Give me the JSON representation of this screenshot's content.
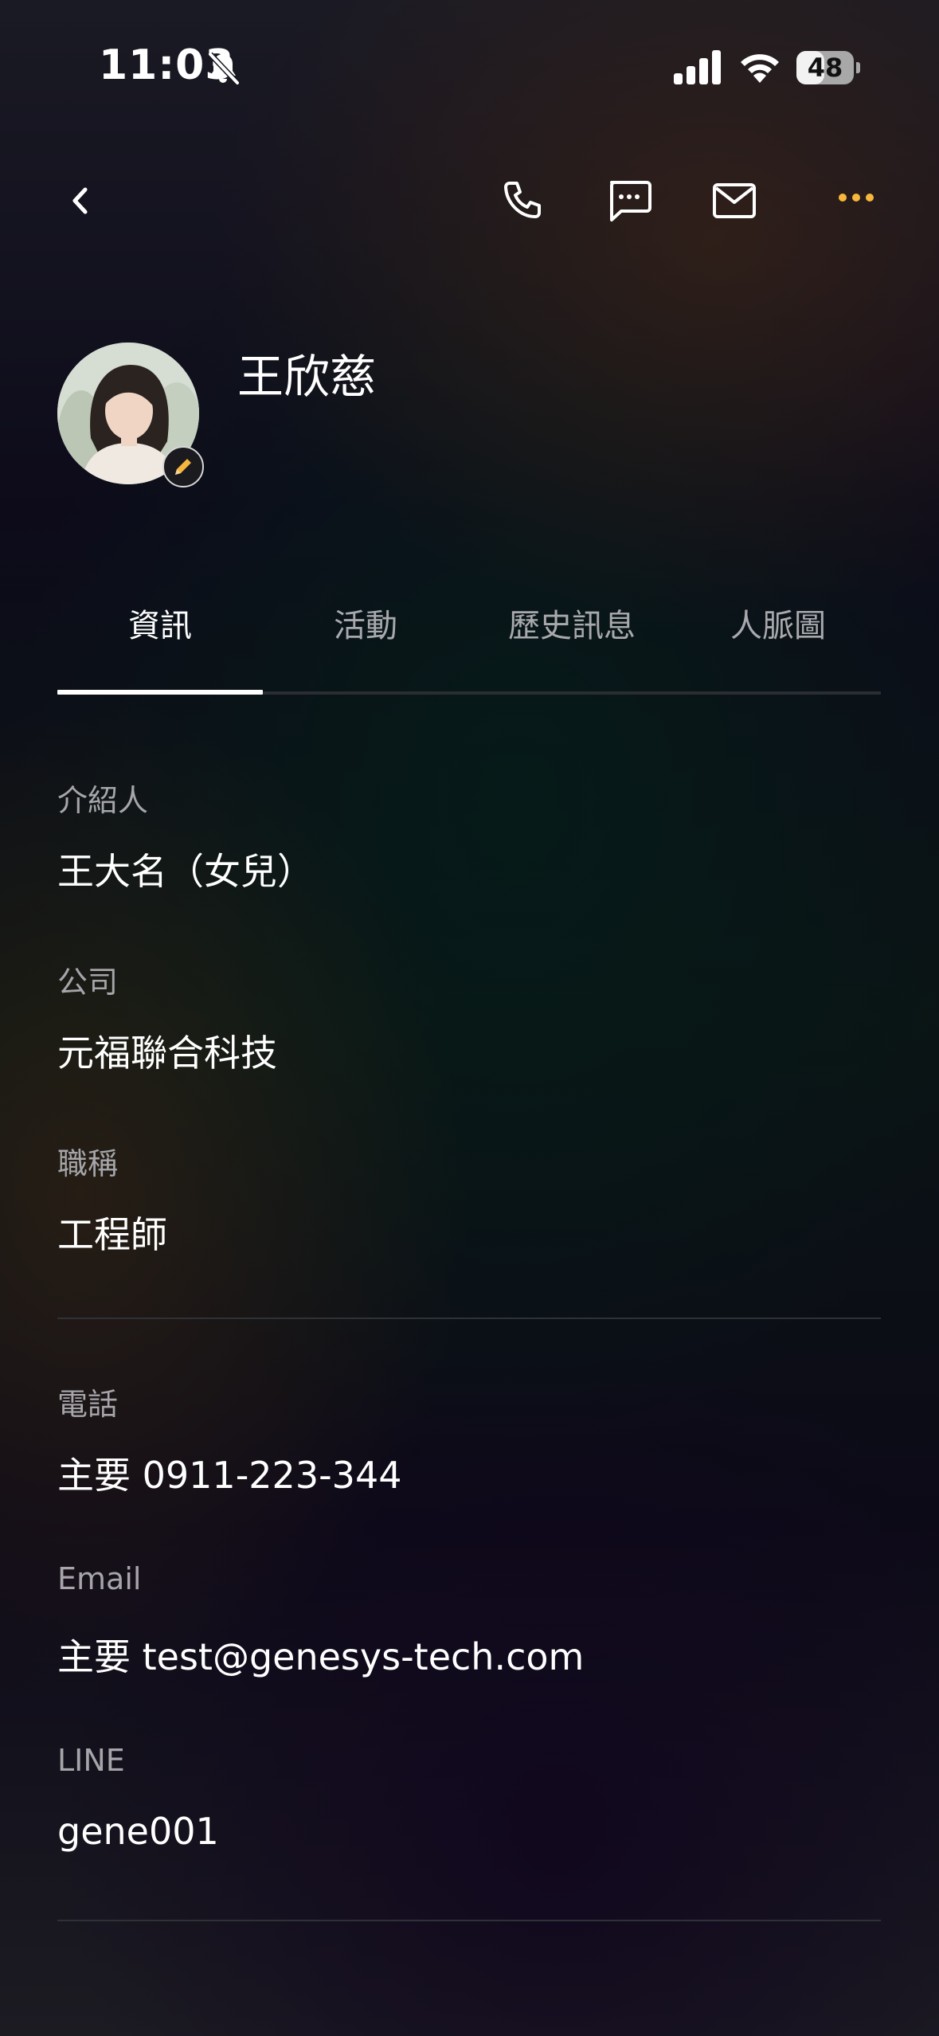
{
  "status_bar": {
    "time": "11:03",
    "battery_level": "48"
  },
  "toolbar": {
    "back_icon": "chevron-left-icon",
    "call_icon": "phone-icon",
    "message_icon": "message-bubble-icon",
    "email_icon": "envelope-icon",
    "more_icon": "ellipsis-icon",
    "accent_color": "#f6b73c"
  },
  "profile": {
    "name": "王欣慈",
    "edit_icon": "pencil-icon"
  },
  "tabs": [
    {
      "label": "資訊",
      "active": true
    },
    {
      "label": "活動",
      "active": false
    },
    {
      "label": "歷史訊息",
      "active": false
    },
    {
      "label": "人脈圖",
      "active": false
    }
  ],
  "info": {
    "referrer": {
      "label": "介紹人",
      "value": "王大名（女兒）"
    },
    "company": {
      "label": "公司",
      "value": "元福聯合科技"
    },
    "title": {
      "label": "職稱",
      "value": "工程師"
    },
    "phone": {
      "label": "電話",
      "value": "主要 0911-223-344"
    },
    "email": {
      "label": "Email",
      "value": "主要 test@genesys-tech.com"
    },
    "line": {
      "label": "LINE",
      "value": "gene001"
    }
  }
}
